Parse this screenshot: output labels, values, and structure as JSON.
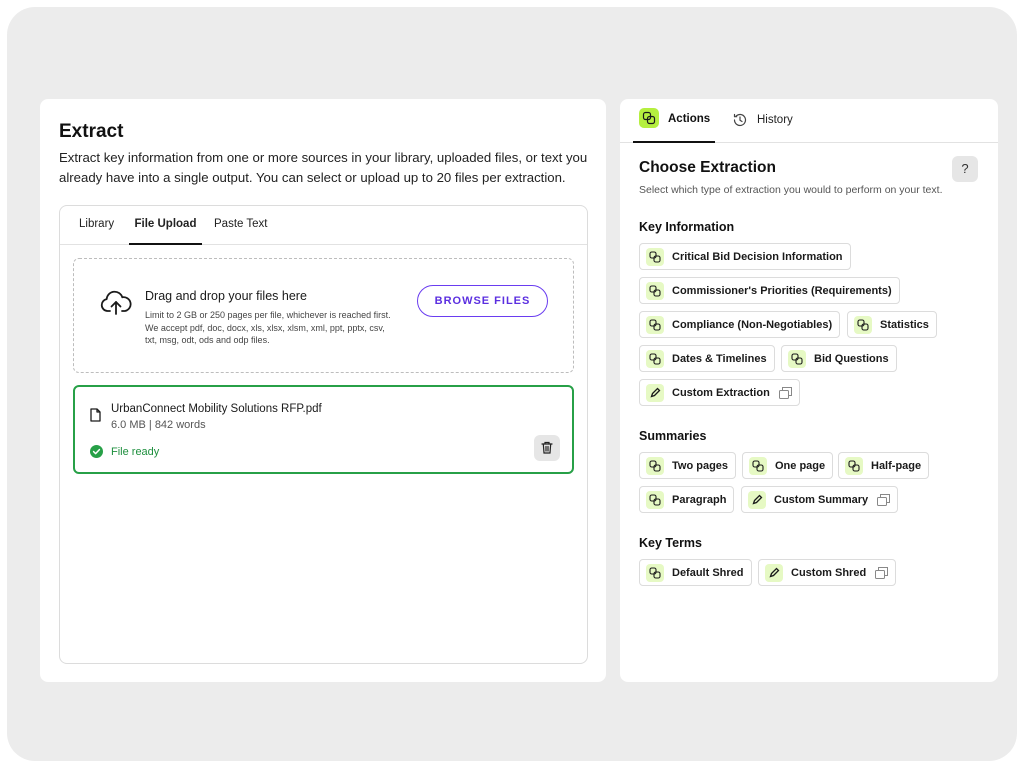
{
  "left": {
    "title": "Extract",
    "description": "Extract key information from one or more sources in your library, uploaded files, or text you already have into a single output. You can select or upload up to 20 files per extraction.",
    "tabs": [
      {
        "label": "Library",
        "active": false
      },
      {
        "label": "File Upload",
        "active": true
      },
      {
        "label": "Paste Text",
        "active": false
      }
    ],
    "dropzone": {
      "title": "Drag and drop your files here",
      "note": "Limit to 2 GB or 250 pages per file, whichever is reached first. We accept pdf, doc, docx, xls, xlsx, xlsm, xml, ppt, pptx, csv, txt, msg, odt, ods and odp files.",
      "browse_label": "BROWSE FILES"
    },
    "file": {
      "name": "UrbanConnect Mobility Solutions RFP.pdf",
      "meta": "6.0 MB | 842 words",
      "status": "File ready"
    }
  },
  "right": {
    "tabs": {
      "actions": "Actions",
      "history": "History"
    },
    "title": "Choose Extraction",
    "subtitle": "Select which type of extraction you would to perform on your text.",
    "help_label": "?",
    "sections": {
      "key_information": {
        "title": "Key Information",
        "chips": [
          {
            "label": "Critical Bid Decision Information",
            "icon": "shred-icon"
          },
          {
            "label": "Commissioner's Priorities (Requirements)",
            "icon": "shred-icon"
          },
          {
            "label": "Compliance (Non-Negotiables)",
            "icon": "shred-icon"
          },
          {
            "label": "Statistics",
            "icon": "shred-icon"
          },
          {
            "label": "Dates & Timelines",
            "icon": "shred-icon"
          },
          {
            "label": "Bid Questions",
            "icon": "shred-icon"
          },
          {
            "label": "Custom Extraction",
            "icon": "pencil-icon"
          }
        ]
      },
      "summaries": {
        "title": "Summaries",
        "chips": [
          {
            "label": "Two pages",
            "icon": "shred-icon"
          },
          {
            "label": "One page",
            "icon": "shred-icon"
          },
          {
            "label": "Half-page",
            "icon": "shred-icon"
          },
          {
            "label": "Paragraph",
            "icon": "shred-icon"
          },
          {
            "label": "Custom Summary",
            "icon": "pencil-icon"
          }
        ]
      },
      "key_terms": {
        "title": "Key Terms",
        "chips": [
          {
            "label": "Default Shred",
            "icon": "shred-icon"
          },
          {
            "label": "Custom Shred",
            "icon": "pencil-icon"
          }
        ]
      }
    }
  },
  "colors": {
    "accent_purple": "#6a3df0",
    "success_green": "#27a047",
    "lime": "#b5ef3f",
    "lime_light": "#e6f9c4"
  }
}
